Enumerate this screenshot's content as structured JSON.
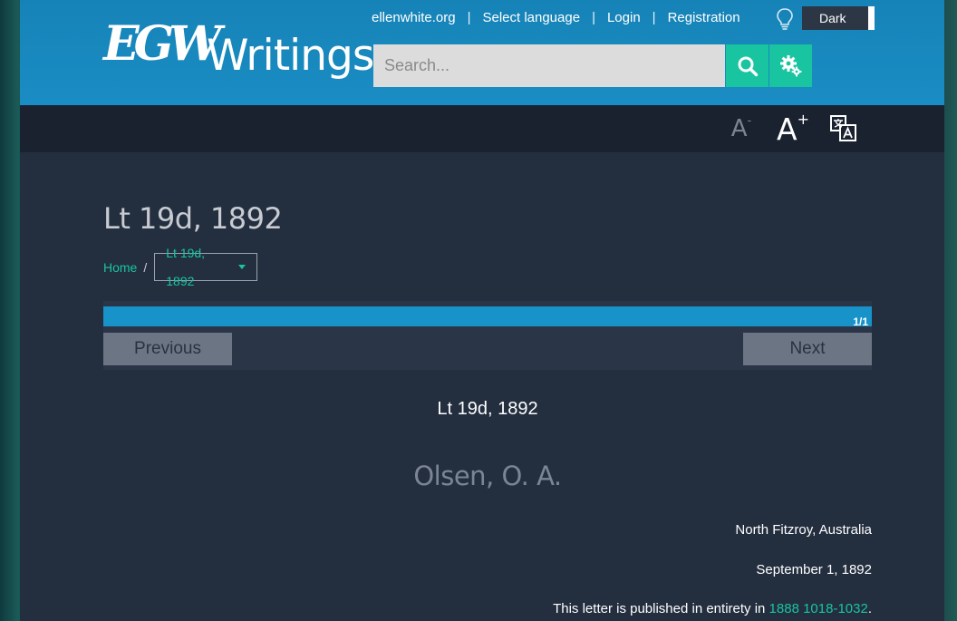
{
  "brand": {
    "logo_mark": "EGW",
    "name": "Writings"
  },
  "top_links": [
    "ellenwhite.org",
    "Select language",
    "Login",
    "Registration"
  ],
  "theme_toggle": {
    "label": "Dark"
  },
  "search": {
    "placeholder": "Search..."
  },
  "toolbar": {
    "font_decrease": "A",
    "font_increase": "A",
    "icons": [
      "search-icon",
      "gear-icon",
      "font-decrease-icon",
      "font-increase-icon",
      "translate-icon",
      "lightbulb-icon"
    ]
  },
  "document": {
    "title": "Lt 19d, 1892",
    "breadcrumb": {
      "home": "Home",
      "current": "Lt 19d, 1892"
    },
    "progress": {
      "text": "1/1",
      "fraction": 1.0
    },
    "nav": {
      "previous": "Previous",
      "next": "Next"
    },
    "sub_title": "Lt 19d, 1892",
    "recipient": "Olsen, O. A.",
    "place": "North Fitzroy, Australia",
    "date": "September 1, 1892",
    "note": {
      "prefix": "This letter is published in entirety in ",
      "link": "1888 1018-1032",
      "suffix": "."
    }
  },
  "colors": {
    "header": "#1a8dc4",
    "accent": "#19c4a0",
    "background": "#232e3f",
    "toolbar": "#1a2230"
  }
}
